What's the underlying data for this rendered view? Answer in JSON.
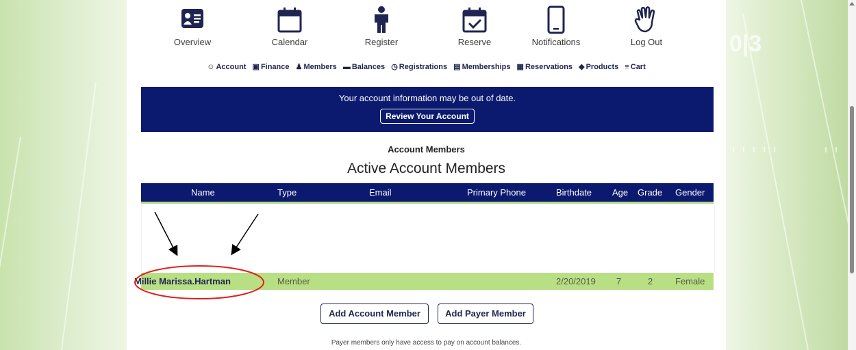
{
  "nav": {
    "items": [
      {
        "label": "Overview",
        "icon": "id-card-icon"
      },
      {
        "label": "Calendar",
        "icon": "calendar-icon"
      },
      {
        "label": "Register",
        "icon": "person-icon"
      },
      {
        "label": "Reserve",
        "icon": "calendar-check-icon"
      },
      {
        "label": "Notifications",
        "icon": "phone-icon"
      },
      {
        "label": "Log Out",
        "icon": "hand-wave-icon"
      }
    ]
  },
  "submenu": [
    {
      "label": "Account",
      "icon": "user-circle-icon"
    },
    {
      "label": "Finance",
      "icon": "money-icon"
    },
    {
      "label": "Members",
      "icon": "users-icon"
    },
    {
      "label": "Balances",
      "icon": "balance-icon"
    },
    {
      "label": "Registrations",
      "icon": "clock-icon"
    },
    {
      "label": "Memberships",
      "icon": "membership-card-icon"
    },
    {
      "label": "Reservations",
      "icon": "calendar-small-icon"
    },
    {
      "label": "Products",
      "icon": "tag-icon"
    },
    {
      "label": "Cart",
      "icon": "cart-icon"
    }
  ],
  "banner": {
    "message": "Your account information may be out of date.",
    "button": "Review Your Account"
  },
  "section_title": "Account Members",
  "active_title": "Active Account Members",
  "table": {
    "headers": [
      "Name",
      "Type",
      "Email",
      "Primary Phone",
      "Birthdate",
      "Age",
      "Grade",
      "Gender"
    ],
    "rows": [
      {
        "name": "Millie Marissa.Hartman",
        "type": "Member",
        "email": "",
        "phone": "",
        "birthdate": "2/20/2019",
        "age": "7",
        "grade": "2",
        "gender": "Female"
      }
    ]
  },
  "buttons": {
    "add_account_member": "Add Account Member",
    "add_payer_member": "Add Payer Member"
  },
  "note": "Payer members only have access to pay on account balances.",
  "background_text": {
    "field_number": "0|3"
  },
  "colors": {
    "navy": "#0b1a6e",
    "row_green": "#b9df85",
    "annotation_red": "#e0201c"
  }
}
